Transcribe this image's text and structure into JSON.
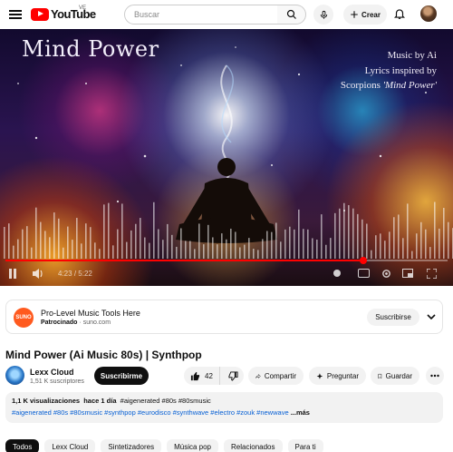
{
  "header": {
    "logo_text": "YouTube",
    "region": "VE",
    "search_placeholder": "Buscar",
    "create_label": "Crear"
  },
  "player": {
    "overlay_title": "Mind Power",
    "credit_line1": "Music by Ai",
    "credit_line2": "Lyrics inspired by",
    "credit_line3_pre": "Scorpions ",
    "credit_line3_em": "'Mind Power'",
    "current_time": "4:23",
    "separator": "/",
    "duration": "5:22",
    "progress_fraction": 0.81
  },
  "ad": {
    "logo_text": "SUNO",
    "title": "Pro-Level Music Tools Here",
    "sponsored_label": "Patrocinado",
    "domain": "suno.com",
    "subscribe_label": "Suscribirse"
  },
  "video": {
    "title": "Mind Power (Ai Music 80s) | Synthpop"
  },
  "channel": {
    "name": "Lexx Cloud",
    "subscribers": "1,51 K suscriptores",
    "subscribe_label": "Suscribirme"
  },
  "actions": {
    "likes": "42",
    "share_label": "Compartir",
    "ask_label": "Preguntar",
    "save_label": "Guardar"
  },
  "description": {
    "views": "1,1 K visualizaciones",
    "age": "hace 1 día",
    "tags_line1": "#aigenerated #80s #80smusic",
    "tags_line2": "#aigenerated #80s #80smusic #synthpop #eurodisco #synthwave #electro #zouk #newwave",
    "more_label": "...más"
  },
  "chips": [
    "Todos",
    "Lexx Cloud",
    "Sintetizadores",
    "Música pop",
    "Relacionados",
    "Para ti"
  ],
  "colors": {
    "brand_red": "#ff0000",
    "link_blue": "#065fd4",
    "chip_bg": "#f2f2f2",
    "text": "#0f0f0f",
    "secondary_text": "#606060"
  }
}
